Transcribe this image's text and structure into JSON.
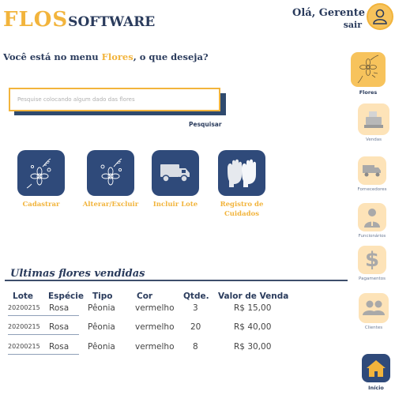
{
  "header": {
    "logo_flos": "FLOS",
    "logo_software": "SOFTWARE",
    "greeting": "Olá, Gerente",
    "logout": "sair"
  },
  "menu": {
    "question_prefix": "Você está no menu ",
    "current_menu": "Flores",
    "question_suffix": ", o que deseja?"
  },
  "search": {
    "placeholder": "Pesquise colocando algum dado das flores",
    "button_label": "Pesquisar"
  },
  "actions": [
    {
      "label": "Cadastrar",
      "icon": "flower-sketch-icon"
    },
    {
      "label": "Alterar/Excluir",
      "icon": "flower-sketch-icon"
    },
    {
      "label": "Incluir Lote",
      "icon": "truck-icon"
    },
    {
      "label": "Registro de Cuidados",
      "icon": "gloves-icon"
    }
  ],
  "recent_sales": {
    "title": "Ultimas flores vendidas",
    "columns": [
      "Lote",
      "Espécie",
      "Tipo",
      "Cor",
      "Qtde.",
      "Valor de Venda"
    ],
    "rows": [
      {
        "lote": "20200215",
        "especie": "Rosa",
        "tipo": "Pêonia",
        "cor": "vermelho",
        "qtde": "3",
        "valor": "R$ 15,00"
      },
      {
        "lote": "20200215",
        "especie": "Rosa",
        "tipo": "Pêonia",
        "cor": "vermelho",
        "qtde": "20",
        "valor": "R$ 40,00"
      },
      {
        "lote": "20200215",
        "especie": "Rosa",
        "tipo": "Pêonia",
        "cor": "vermelho",
        "qtde": "8",
        "valor": "R$ 30,00"
      }
    ]
  },
  "nav": [
    {
      "label": "Flores",
      "icon": "flower-icon",
      "active": true
    },
    {
      "label": "Vendas",
      "icon": "cash-register-icon"
    },
    {
      "label": "Fornecedores",
      "icon": "truck-icon"
    },
    {
      "label": "Funcionários",
      "icon": "employee-icon"
    },
    {
      "label": "Pagamentos",
      "icon": "dollar-icon"
    },
    {
      "label": "Clientes",
      "icon": "clients-icon"
    },
    {
      "label": "Início",
      "icon": "home-icon"
    }
  ],
  "colors": {
    "brand_yellow": "#f2b43c",
    "navy": "#2a3b5c",
    "tile_blue": "#2f4a7a",
    "nav_bg": "#fde3b8"
  }
}
